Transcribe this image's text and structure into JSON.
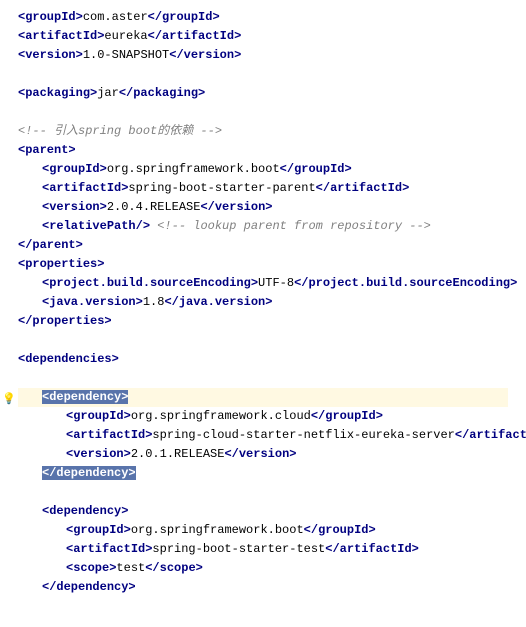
{
  "lines": [
    {
      "indent": 0,
      "parts": [
        {
          "t": "ang",
          "v": "<"
        },
        {
          "t": "tag",
          "v": "groupId"
        },
        {
          "t": "ang",
          "v": ">"
        },
        {
          "t": "text",
          "v": "com.aster"
        },
        {
          "t": "ang",
          "v": "</"
        },
        {
          "t": "tag",
          "v": "groupId"
        },
        {
          "t": "ang",
          "v": ">"
        }
      ]
    },
    {
      "indent": 0,
      "parts": [
        {
          "t": "ang",
          "v": "<"
        },
        {
          "t": "tag",
          "v": "artifactId"
        },
        {
          "t": "ang",
          "v": ">"
        },
        {
          "t": "text",
          "v": "eureka"
        },
        {
          "t": "ang",
          "v": "</"
        },
        {
          "t": "tag",
          "v": "artifactId"
        },
        {
          "t": "ang",
          "v": ">"
        }
      ]
    },
    {
      "indent": 0,
      "parts": [
        {
          "t": "ang",
          "v": "<"
        },
        {
          "t": "tag",
          "v": "version"
        },
        {
          "t": "ang",
          "v": ">"
        },
        {
          "t": "text",
          "v": "1.0-SNAPSHOT"
        },
        {
          "t": "ang",
          "v": "</"
        },
        {
          "t": "tag",
          "v": "version"
        },
        {
          "t": "ang",
          "v": ">"
        }
      ]
    },
    {
      "blank": true
    },
    {
      "indent": 0,
      "parts": [
        {
          "t": "ang",
          "v": "<"
        },
        {
          "t": "tag",
          "v": "packaging"
        },
        {
          "t": "ang",
          "v": ">"
        },
        {
          "t": "text",
          "v": "jar"
        },
        {
          "t": "ang",
          "v": "</"
        },
        {
          "t": "tag",
          "v": "packaging"
        },
        {
          "t": "ang",
          "v": ">"
        }
      ]
    },
    {
      "blank": true
    },
    {
      "indent": 0,
      "parts": [
        {
          "t": "comment",
          "v": "<!-- 引入spring boot的依赖 -->"
        }
      ]
    },
    {
      "indent": 0,
      "parts": [
        {
          "t": "ang",
          "v": "<"
        },
        {
          "t": "tag",
          "v": "parent"
        },
        {
          "t": "ang",
          "v": ">"
        }
      ]
    },
    {
      "indent": 1,
      "parts": [
        {
          "t": "ang",
          "v": "<"
        },
        {
          "t": "tag",
          "v": "groupId"
        },
        {
          "t": "ang",
          "v": ">"
        },
        {
          "t": "text",
          "v": "org.springframework.boot"
        },
        {
          "t": "ang",
          "v": "</"
        },
        {
          "t": "tag",
          "v": "groupId"
        },
        {
          "t": "ang",
          "v": ">"
        }
      ]
    },
    {
      "indent": 1,
      "parts": [
        {
          "t": "ang",
          "v": "<"
        },
        {
          "t": "tag",
          "v": "artifactId"
        },
        {
          "t": "ang",
          "v": ">"
        },
        {
          "t": "text",
          "v": "spring-boot-starter-parent"
        },
        {
          "t": "ang",
          "v": "</"
        },
        {
          "t": "tag",
          "v": "artifactId"
        },
        {
          "t": "ang",
          "v": ">"
        }
      ]
    },
    {
      "indent": 1,
      "parts": [
        {
          "t": "ang",
          "v": "<"
        },
        {
          "t": "tag",
          "v": "version"
        },
        {
          "t": "ang",
          "v": ">"
        },
        {
          "t": "text",
          "v": "2.0.4.RELEASE"
        },
        {
          "t": "ang",
          "v": "</"
        },
        {
          "t": "tag",
          "v": "version"
        },
        {
          "t": "ang",
          "v": ">"
        }
      ]
    },
    {
      "indent": 1,
      "parts": [
        {
          "t": "ang",
          "v": "<"
        },
        {
          "t": "tag",
          "v": "relativePath"
        },
        {
          "t": "ang",
          "v": "/>"
        },
        {
          "t": "text",
          "v": " "
        },
        {
          "t": "comment",
          "v": "<!-- lookup parent from repository -->"
        }
      ]
    },
    {
      "indent": 0,
      "parts": [
        {
          "t": "ang",
          "v": "</"
        },
        {
          "t": "tag",
          "v": "parent"
        },
        {
          "t": "ang",
          "v": ">"
        }
      ]
    },
    {
      "indent": 0,
      "parts": [
        {
          "t": "ang",
          "v": "<"
        },
        {
          "t": "tag",
          "v": "properties"
        },
        {
          "t": "ang",
          "v": ">"
        }
      ]
    },
    {
      "indent": 1,
      "parts": [
        {
          "t": "ang",
          "v": "<"
        },
        {
          "t": "tag",
          "v": "project.build.sourceEncoding"
        },
        {
          "t": "ang",
          "v": ">"
        },
        {
          "t": "text",
          "v": "UTF-8"
        },
        {
          "t": "ang",
          "v": "</"
        },
        {
          "t": "tag",
          "v": "project.build.sourceEncoding"
        },
        {
          "t": "ang",
          "v": ">"
        }
      ]
    },
    {
      "indent": 1,
      "parts": [
        {
          "t": "ang",
          "v": "<"
        },
        {
          "t": "tag",
          "v": "java.version"
        },
        {
          "t": "ang",
          "v": ">"
        },
        {
          "t": "text",
          "v": "1.8"
        },
        {
          "t": "ang",
          "v": "</"
        },
        {
          "t": "tag",
          "v": "java.version"
        },
        {
          "t": "ang",
          "v": ">"
        }
      ]
    },
    {
      "indent": 0,
      "parts": [
        {
          "t": "ang",
          "v": "</"
        },
        {
          "t": "tag",
          "v": "properties"
        },
        {
          "t": "ang",
          "v": ">"
        }
      ]
    },
    {
      "blank": true
    },
    {
      "indent": 0,
      "parts": [
        {
          "t": "ang",
          "v": "<"
        },
        {
          "t": "tag",
          "v": "dependencies"
        },
        {
          "t": "ang",
          "v": ">"
        }
      ]
    },
    {
      "blank": true
    },
    {
      "indent": 1,
      "hl": true,
      "selwrap": true,
      "parts": [
        {
          "t": "ang",
          "v": "<"
        },
        {
          "t": "tag",
          "v": "dependency"
        },
        {
          "t": "ang",
          "v": ">"
        }
      ]
    },
    {
      "indent": 2,
      "parts": [
        {
          "t": "ang",
          "v": "<"
        },
        {
          "t": "tag",
          "v": "groupId"
        },
        {
          "t": "ang",
          "v": ">"
        },
        {
          "t": "text",
          "v": "org.springframework.cloud"
        },
        {
          "t": "ang",
          "v": "</"
        },
        {
          "t": "tag",
          "v": "groupId"
        },
        {
          "t": "ang",
          "v": ">"
        }
      ]
    },
    {
      "indent": 2,
      "parts": [
        {
          "t": "ang",
          "v": "<"
        },
        {
          "t": "tag",
          "v": "artifactId"
        },
        {
          "t": "ang",
          "v": ">"
        },
        {
          "t": "text",
          "v": "spring-cloud-starter-netflix-eureka-server"
        },
        {
          "t": "ang",
          "v": "</"
        },
        {
          "t": "tag",
          "v": "artifactId"
        },
        {
          "t": "ang",
          "v": ">"
        }
      ]
    },
    {
      "indent": 2,
      "parts": [
        {
          "t": "ang",
          "v": "<"
        },
        {
          "t": "tag",
          "v": "version"
        },
        {
          "t": "ang",
          "v": ">"
        },
        {
          "t": "text",
          "v": "2.0.1.RELEASE"
        },
        {
          "t": "ang",
          "v": "</"
        },
        {
          "t": "tag",
          "v": "version"
        },
        {
          "t": "ang",
          "v": ">"
        }
      ]
    },
    {
      "indent": 1,
      "selwrap": true,
      "parts": [
        {
          "t": "ang",
          "v": "</"
        },
        {
          "t": "tag",
          "v": "dependency"
        },
        {
          "t": "ang",
          "v": ">"
        }
      ]
    },
    {
      "blank": true
    },
    {
      "indent": 1,
      "parts": [
        {
          "t": "ang",
          "v": "<"
        },
        {
          "t": "tag",
          "v": "dependency"
        },
        {
          "t": "ang",
          "v": ">"
        }
      ]
    },
    {
      "indent": 2,
      "parts": [
        {
          "t": "ang",
          "v": "<"
        },
        {
          "t": "tag",
          "v": "groupId"
        },
        {
          "t": "ang",
          "v": ">"
        },
        {
          "t": "text",
          "v": "org.springframework.boot"
        },
        {
          "t": "ang",
          "v": "</"
        },
        {
          "t": "tag",
          "v": "groupId"
        },
        {
          "t": "ang",
          "v": ">"
        }
      ]
    },
    {
      "indent": 2,
      "parts": [
        {
          "t": "ang",
          "v": "<"
        },
        {
          "t": "tag",
          "v": "artifactId"
        },
        {
          "t": "ang",
          "v": ">"
        },
        {
          "t": "text",
          "v": "spring-boot-starter-test"
        },
        {
          "t": "ang",
          "v": "</"
        },
        {
          "t": "tag",
          "v": "artifactId"
        },
        {
          "t": "ang",
          "v": ">"
        }
      ]
    },
    {
      "indent": 2,
      "parts": [
        {
          "t": "ang",
          "v": "<"
        },
        {
          "t": "tag",
          "v": "scope"
        },
        {
          "t": "ang",
          "v": ">"
        },
        {
          "t": "text",
          "v": "test"
        },
        {
          "t": "ang",
          "v": "</"
        },
        {
          "t": "tag",
          "v": "scope"
        },
        {
          "t": "ang",
          "v": ">"
        }
      ]
    },
    {
      "indent": 1,
      "parts": [
        {
          "t": "ang",
          "v": "</"
        },
        {
          "t": "tag",
          "v": "dependency"
        },
        {
          "t": "ang",
          "v": ">"
        }
      ]
    }
  ],
  "bulb_icon": "💡"
}
